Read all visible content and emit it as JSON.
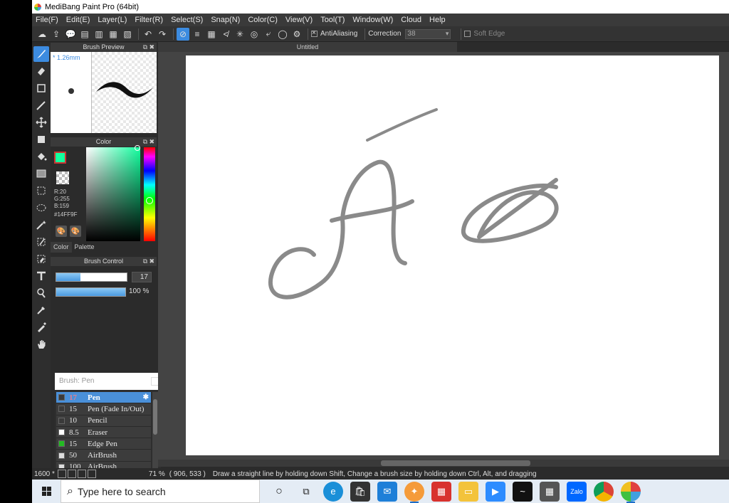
{
  "window": {
    "title": "MediBang Paint Pro (64bit)"
  },
  "menu": [
    "File(F)",
    "Edit(E)",
    "Layer(L)",
    "Filter(R)",
    "Select(S)",
    "Snap(N)",
    "Color(C)",
    "View(V)",
    "Tool(T)",
    "Window(W)",
    "Cloud",
    "Help"
  ],
  "toolbar": {
    "antialiasing_label": "AntiAliasing",
    "correction_label": "Correction",
    "correction_value": "38",
    "soft_edge_label": "Soft Edge"
  },
  "brush_preview": {
    "title": "Brush Preview",
    "size": "* 1.26mm"
  },
  "color_panel": {
    "title": "Color",
    "r": "R:20",
    "g": "G:255",
    "b": "B:159",
    "hex": "#14FF9F",
    "tab_color": "Color",
    "tab_palette": "Palette",
    "fg_color": "#14FF9F"
  },
  "brush_control": {
    "title": "Brush Control",
    "size_value": "17",
    "opacity_value": "100 %",
    "size_fill": 0.34,
    "opacity_fill": 1.0
  },
  "brush_list": {
    "title": "Brush: Pen",
    "items": [
      {
        "size": "17",
        "name": "Pen",
        "color": "#3a3a3a"
      },
      {
        "size": "15",
        "name": "Pen (Fade In/Out)",
        "color": "#3a3a3a"
      },
      {
        "size": "10",
        "name": "Pencil",
        "color": "#3a3a3a"
      },
      {
        "size": "8.5",
        "name": "Eraser",
        "color": "#ffffff"
      },
      {
        "size": "15",
        "name": "Edge Pen",
        "color": "#22bb22"
      },
      {
        "size": "50",
        "name": "AirBrush",
        "color": "#dddddd"
      },
      {
        "size": "100",
        "name": "AirBrush",
        "color": "#dddddd"
      }
    ]
  },
  "canvas": {
    "tab_title": "Untitled"
  },
  "status": {
    "left": "1600 *",
    "zoom": "71 %",
    "coords": "( 906, 533 )",
    "hint": "Draw a straight line by holding down Shift, Change a brush size by holding down Ctrl, Alt, and dragging"
  },
  "taskbar": {
    "search_placeholder": "Type here to search"
  }
}
